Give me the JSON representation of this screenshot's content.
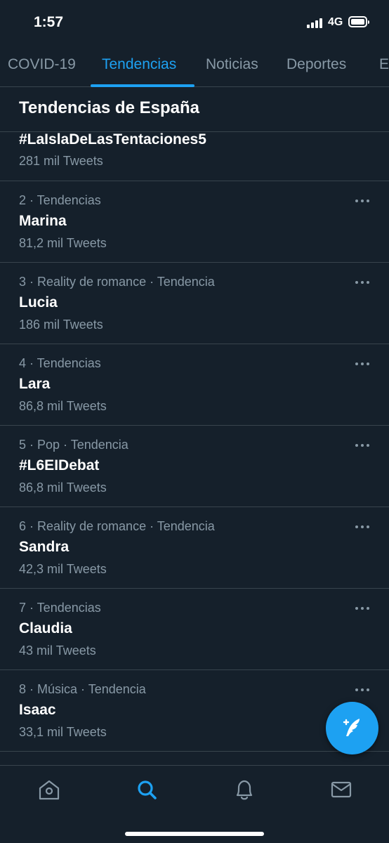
{
  "status_bar": {
    "time": "1:57",
    "network": "4G"
  },
  "tabs": [
    {
      "label": "COVID-19",
      "active": false
    },
    {
      "label": "Tendencias",
      "active": true
    },
    {
      "label": "Noticias",
      "active": false
    },
    {
      "label": "Deportes",
      "active": false
    },
    {
      "label": "E",
      "active": false
    }
  ],
  "section_title": "Tendencias de España",
  "first_trend": {
    "name": "#LaIslaDeLasTentaciones5",
    "count": "281 mil Tweets"
  },
  "trends": [
    {
      "meta": "2 · Tendencias",
      "name": "Marina",
      "count": "81,2 mil Tweets"
    },
    {
      "meta": "3 · Reality de romance · Tendencia",
      "name": "Lucia",
      "count": "186 mil Tweets"
    },
    {
      "meta": "4 · Tendencias",
      "name": "Lara",
      "count": "86,8 mil Tweets"
    },
    {
      "meta": "5 · Pop · Tendencia",
      "name": "#L6EIDebat",
      "count": "86,8 mil Tweets"
    },
    {
      "meta": "6 · Reality de romance · Tendencia",
      "name": "Sandra",
      "count": "42,3 mil Tweets"
    },
    {
      "meta": "7 · Tendencias",
      "name": "Claudia",
      "count": "43 mil Tweets"
    },
    {
      "meta": "8 · Música · Tendencia",
      "name": "Isaac",
      "count": "33,1 mil Tweets"
    }
  ],
  "icons": {
    "fab": "compose-tweet-icon",
    "nav": [
      "home-icon",
      "search-icon",
      "notifications-bell-icon",
      "messages-mail-icon"
    ]
  },
  "colors": {
    "background": "#15202b",
    "accent": "#1da1f2",
    "secondary_text": "#8899a6",
    "divider": "#38444d"
  }
}
